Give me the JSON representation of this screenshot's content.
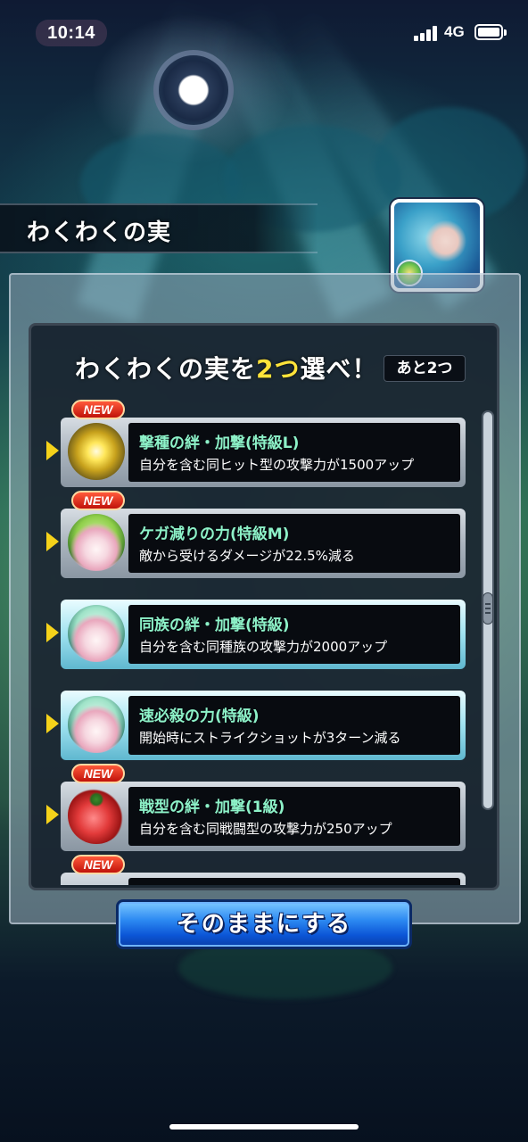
{
  "status_bar": {
    "time": "10:14",
    "network": "4G"
  },
  "banner": {
    "title": "わくわくの実"
  },
  "panel": {
    "heading_prefix": "わくわくの実を",
    "heading_highlight": "2つ",
    "heading_suffix": "選べ！",
    "remaining_label": "あと2つ",
    "highlight_color": "#ffe33a"
  },
  "items": [
    {
      "new": "NEW",
      "name": "撃種の絆・加撃(特級L)",
      "description": "自分を含む同ヒット型の攻撃力が1500アップ",
      "icon": "gold-fruit-icon"
    },
    {
      "new": "NEW",
      "name": "ケガ減りの力(特級M)",
      "description": "敵から受けるダメージが22.5%減る",
      "icon": "green-fruit-icon"
    },
    {
      "name": "同族の絆・加撃(特級)",
      "description": "自分を含む同種族の攻撃力が2000アップ",
      "icon": "frost-fruit-icon"
    },
    {
      "name": "速必殺の力(特級)",
      "description": "開始時にストライクショットが3ターン減る",
      "icon": "frost-fruit-icon"
    },
    {
      "new": "NEW",
      "name": "戦型の絆・加撃(1級)",
      "description": "自分を含む同戦闘型の攻撃力が250アップ",
      "icon": "red-fruit-icon"
    },
    {
      "new": "NEW"
    }
  ],
  "buttons": {
    "leave_as_is": "そのままにする"
  },
  "colors": {
    "item_name": "#8df2c8",
    "new_badge": "#e0281a",
    "button_blue": "#1f72e8",
    "arrow_yellow": "#f5d21a"
  }
}
